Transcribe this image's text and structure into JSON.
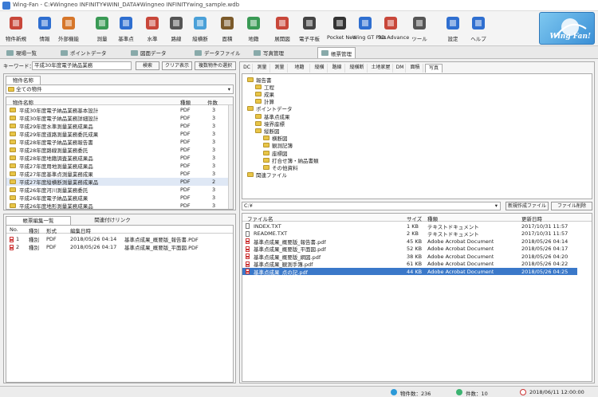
{
  "window": {
    "title": "Wing-Fan - C:¥Wingneo INFINITY¥WINI_DATA¥Wingneo INFINITYwing_sample.wdb"
  },
  "toolbar": {
    "buttons": [
      {
        "label": "物件新規",
        "icon": "new-project-icon"
      },
      {
        "label": "情報",
        "icon": "info-icon"
      },
      {
        "label": "外部機能",
        "icon": "external-function-icon"
      },
      {
        "label": "測量",
        "icon": "survey-icon"
      },
      {
        "label": "基準点",
        "icon": "control-point-icon"
      },
      {
        "label": "水準",
        "icon": "leveling-icon"
      },
      {
        "label": "路線",
        "icon": "route-icon"
      },
      {
        "label": "縦横断",
        "icon": "cross-section-icon"
      },
      {
        "label": "面積",
        "icon": "area-icon"
      },
      {
        "label": "地籍",
        "icon": "cadastral-icon"
      },
      {
        "label": "展開図",
        "icon": "development-icon"
      },
      {
        "label": "電子平板",
        "icon": "tablet-icon"
      },
      {
        "label": "Pocket Neo",
        "icon": "pocket-neo-icon"
      },
      {
        "label": "Wing GT Plus",
        "icon": "wing-gt-icon"
      },
      {
        "label": "3D Advance",
        "icon": "3d-advance-icon"
      },
      {
        "label": "ツール",
        "icon": "tool-icon"
      },
      {
        "label": "設定",
        "icon": "settings-icon"
      },
      {
        "label": "ヘルプ",
        "icon": "help-icon"
      }
    ],
    "brand": "Wing Fan!"
  },
  "tabs": [
    {
      "label": "現場一覧",
      "icon": "list-icon"
    },
    {
      "label": "ポイントデータ",
      "icon": "point-icon"
    },
    {
      "label": "図面データ",
      "icon": "drawing-icon"
    },
    {
      "label": "データファイル",
      "icon": "file-icon"
    },
    {
      "label": "写真管理",
      "icon": "photo-icon"
    },
    {
      "label": "帳票管理",
      "icon": "report-icon"
    }
  ],
  "search": {
    "label": "キーワード：",
    "value": "平成30年度電子納品業務",
    "buttons": [
      "検索",
      "クリア表示",
      "複数物件の選択"
    ]
  },
  "left_top": {
    "tab": "物件名称",
    "filter": "全ての物件",
    "columns": [
      "物件名称",
      "種類",
      "件数"
    ],
    "rows": [
      {
        "name": "平成30年度電子納品業務基本設計",
        "type": "PDF",
        "count": "3"
      },
      {
        "name": "平成30年度電子納品業務詳細設計",
        "type": "PDF",
        "count": "3"
      },
      {
        "name": "平成29年度水準測量業務成果品",
        "type": "PDF",
        "count": "3"
      },
      {
        "name": "平成29年度道路測量業務委託成果",
        "type": "PDF",
        "count": "3"
      },
      {
        "name": "平成28年度電子納品業務報告書",
        "type": "PDF",
        "count": "3"
      },
      {
        "name": "平成28年度路線測量業務委託",
        "type": "PDF",
        "count": "3"
      },
      {
        "name": "平成28年度地籍調査業務成果品",
        "type": "PDF",
        "count": "3"
      },
      {
        "name": "平成27年度用地測量業務成果品",
        "type": "PDF",
        "count": "3"
      },
      {
        "name": "平成27年度基準点測量業務成果",
        "type": "PDF",
        "count": "3"
      },
      {
        "name": "平成27年度縦横断測量業務成果品",
        "type": "PDF",
        "count": "2"
      },
      {
        "name": "平成26年度河川測量業務委託",
        "type": "PDF",
        "count": "3"
      },
      {
        "name": "平成26年度電子納品業務成果",
        "type": "PDF",
        "count": "3"
      },
      {
        "name": "平成26年度地形測量業務成果品",
        "type": "PDF",
        "count": "3"
      }
    ]
  },
  "left_bottom": {
    "tabs": [
      "帳票編集一覧",
      "関連付けリンク"
    ],
    "columns": [
      "No.",
      "種別",
      "形式",
      "編集日時"
    ],
    "rows": [
      {
        "no": "1",
        "kind": "種別",
        "fmt": "PDF",
        "date": "2018/05/26 04:14",
        "file": "基準点成果_概要版_報告書.PDF"
      },
      {
        "no": "2",
        "kind": "種別",
        "fmt": "PDF",
        "date": "2018/05/26 04:17",
        "file": "基準点成果_概要版_平面図.PDF"
      }
    ]
  },
  "right": {
    "tabs": [
      "DC",
      "測量",
      "測量",
      "地籍",
      "縦横",
      "路線",
      "縦横断",
      "土地家屋",
      "DM",
      "面積",
      "写真"
    ],
    "tree": [
      {
        "label": "報告書",
        "level": 0
      },
      {
        "label": "工程",
        "level": 1
      },
      {
        "label": "成果",
        "level": 1
      },
      {
        "label": "計算",
        "level": 1
      },
      {
        "label": "ポイントデータ",
        "level": 0
      },
      {
        "label": "基準点成果",
        "level": 1
      },
      {
        "label": "境界座標",
        "level": 1
      },
      {
        "label": "縦断図",
        "level": 1
      },
      {
        "label": "横断図",
        "level": 2
      },
      {
        "label": "観測記簿",
        "level": 2
      },
      {
        "label": "座標図",
        "level": 2
      },
      {
        "label": "打合せ簿・納品書類",
        "level": 2
      },
      {
        "label": "その他資料",
        "level": 2
      },
      {
        "label": "関連ファイル",
        "level": 0
      }
    ],
    "path": "C:¥",
    "buttons": [
      "新規作成ファイル",
      "ファイル削除"
    ],
    "columns": [
      "ファイル名",
      "サイズ",
      "種類",
      "更新日時"
    ],
    "files": [
      {
        "name": "INDEX.TXT",
        "size": "1 KB",
        "type": "テキストドキュメント",
        "date": "2017/10/31 11:57",
        "icon": "doc"
      },
      {
        "name": "README.TXT",
        "size": "2 KB",
        "type": "テキストドキュメント",
        "date": "2017/10/31 11:57",
        "icon": "doc"
      },
      {
        "name": "基準点成果_概要版_報告書.pdf",
        "size": "45 KB",
        "type": "Adobe Acrobat Document",
        "date": "2018/05/26 04:14",
        "icon": "pdf"
      },
      {
        "name": "基準点成果_概要版_平面図.pdf",
        "size": "52 KB",
        "type": "Adobe Acrobat Document",
        "date": "2018/05/26 04:17",
        "icon": "pdf"
      },
      {
        "name": "基準点成果_概要版_網図.pdf",
        "size": "38 KB",
        "type": "Adobe Acrobat Document",
        "date": "2018/05/26 04:20",
        "icon": "pdf"
      },
      {
        "name": "基準点成果_観測手簿.pdf",
        "size": "61 KB",
        "type": "Adobe Acrobat Document",
        "date": "2018/05/26 04:22",
        "icon": "pdf"
      },
      {
        "name": "基準点成果_点の記.pdf",
        "size": "44 KB",
        "type": "Adobe Acrobat Document",
        "date": "2018/05/26 04:25",
        "icon": "pdf"
      }
    ],
    "selected_file": 6
  },
  "status": {
    "items": [
      "物件数：236",
      "件数：10",
      "2018/06/11 12:00:00"
    ]
  }
}
